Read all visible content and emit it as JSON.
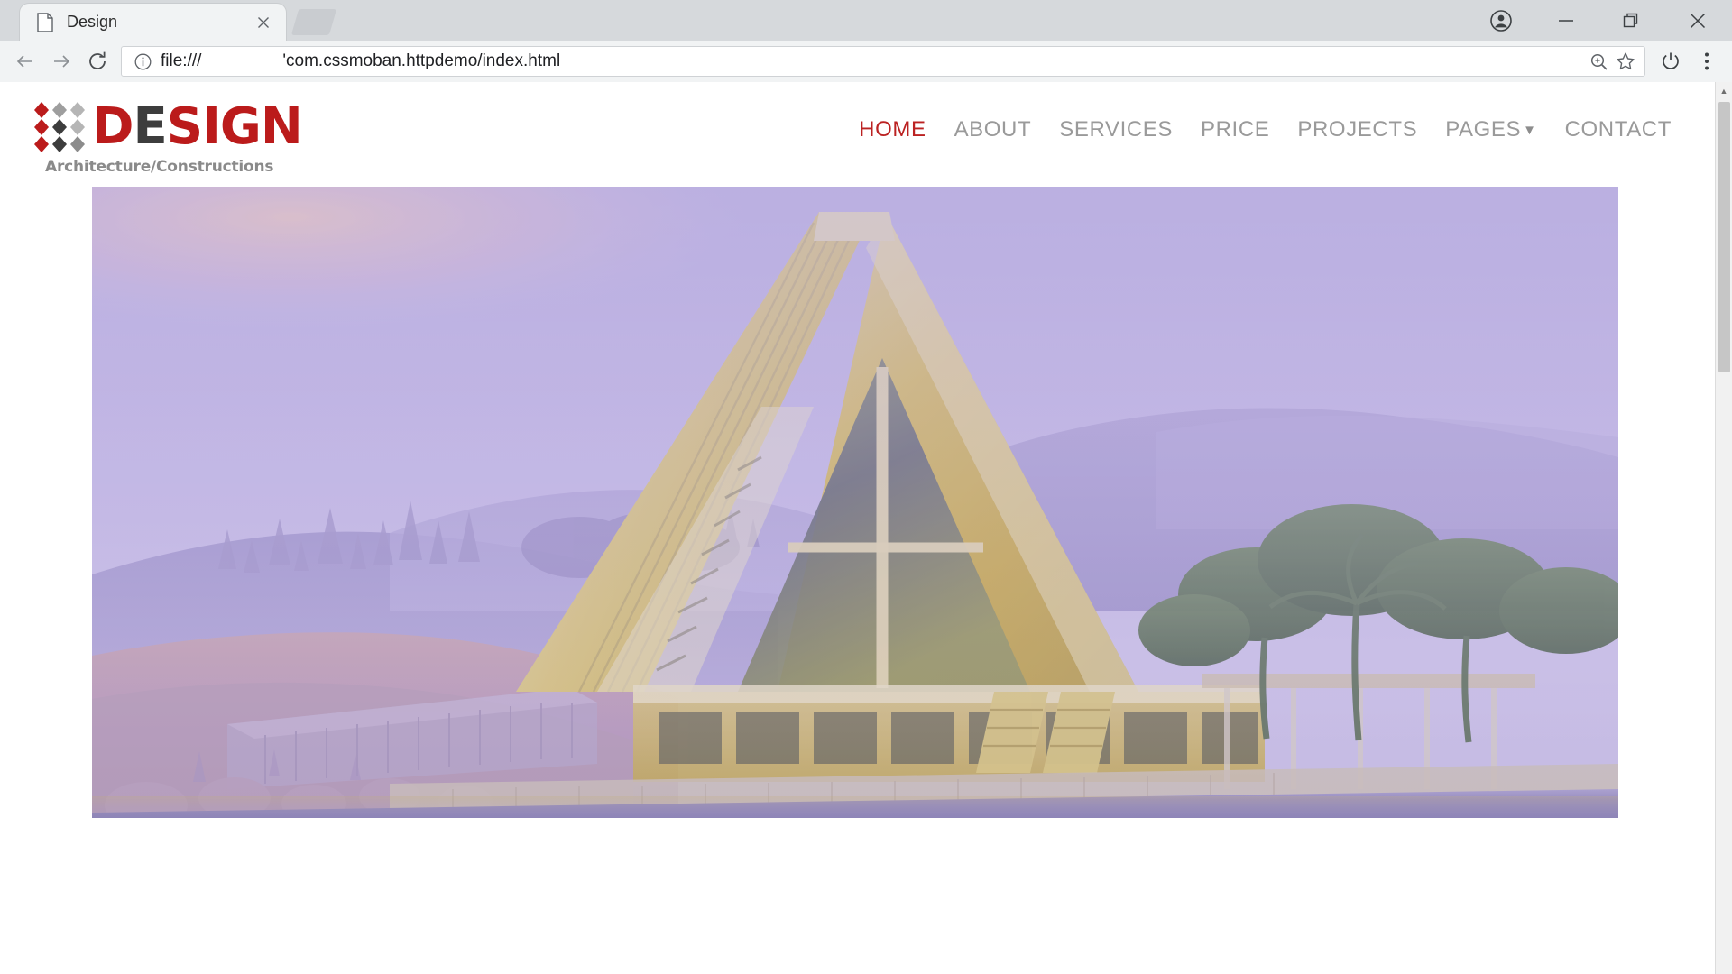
{
  "browser": {
    "tab": {
      "title": "Design",
      "favicon_icon": "page-icon",
      "close_icon": "close-icon"
    },
    "new_tab_icon": "new-tab-icon",
    "window_controls": [
      {
        "name": "profile",
        "icon": "account-circle-icon"
      },
      {
        "name": "minimize",
        "icon": "minimize-icon"
      },
      {
        "name": "maximize",
        "icon": "restore-window-icon"
      },
      {
        "name": "close",
        "icon": "close-icon"
      }
    ],
    "nav_buttons": [
      {
        "name": "back",
        "icon": "arrow-left-icon",
        "enabled": false
      },
      {
        "name": "forward",
        "icon": "arrow-right-icon",
        "enabled": false
      },
      {
        "name": "reload",
        "icon": "reload-icon",
        "enabled": true
      }
    ],
    "address_bar": {
      "info_icon": "info-circle-icon",
      "scheme": "file:///",
      "path": "'com.cssmoban.httpdemo/index.html",
      "zoom_icon": "zoom-in-icon",
      "bookmark_icon": "star-outline-icon"
    },
    "toolbar_right": [
      {
        "name": "power",
        "icon": "power-icon"
      },
      {
        "name": "menu",
        "icon": "three-dots-vertical-icon"
      }
    ]
  },
  "site": {
    "logo": {
      "mark_icon": "diamond-grid-icon",
      "word_d": "D",
      "word_e": "E",
      "word_rest": "SIGN",
      "tagline": "Architecture/Constructions",
      "colors": {
        "red": "#bb1b1b",
        "dark": "#3d3d3d",
        "gray": "#9a9a9a"
      }
    },
    "nav": [
      {
        "label": "HOME",
        "active": true,
        "has_dropdown": false
      },
      {
        "label": "ABOUT",
        "active": false,
        "has_dropdown": false
      },
      {
        "label": "SERVICES",
        "active": false,
        "has_dropdown": false
      },
      {
        "label": "PRICE",
        "active": false,
        "has_dropdown": false
      },
      {
        "label": "PROJECTS",
        "active": false,
        "has_dropdown": false
      },
      {
        "label": "PAGES",
        "active": false,
        "has_dropdown": true,
        "caret": "▼"
      },
      {
        "label": "CONTACT",
        "active": false,
        "has_dropdown": false
      }
    ],
    "hero": {
      "alt": "A-frame glass-and-timber pavilion reflected in a still lake with misty hills behind",
      "palette": {
        "sky_top": "#b9b0e0",
        "sky_haze": "#c9bfe6",
        "hills": "#a79dd0",
        "building_gold": "#d4b135",
        "building_light": "#e8dda4",
        "water": "#9a93c4",
        "foliage": "#4f6b43",
        "sun_glow": "#f0c4a8"
      }
    }
  },
  "page_scrollbar": {
    "up_arrow_icon": "chevron-up-icon",
    "down_arrow_icon": "chevron-down-icon"
  }
}
